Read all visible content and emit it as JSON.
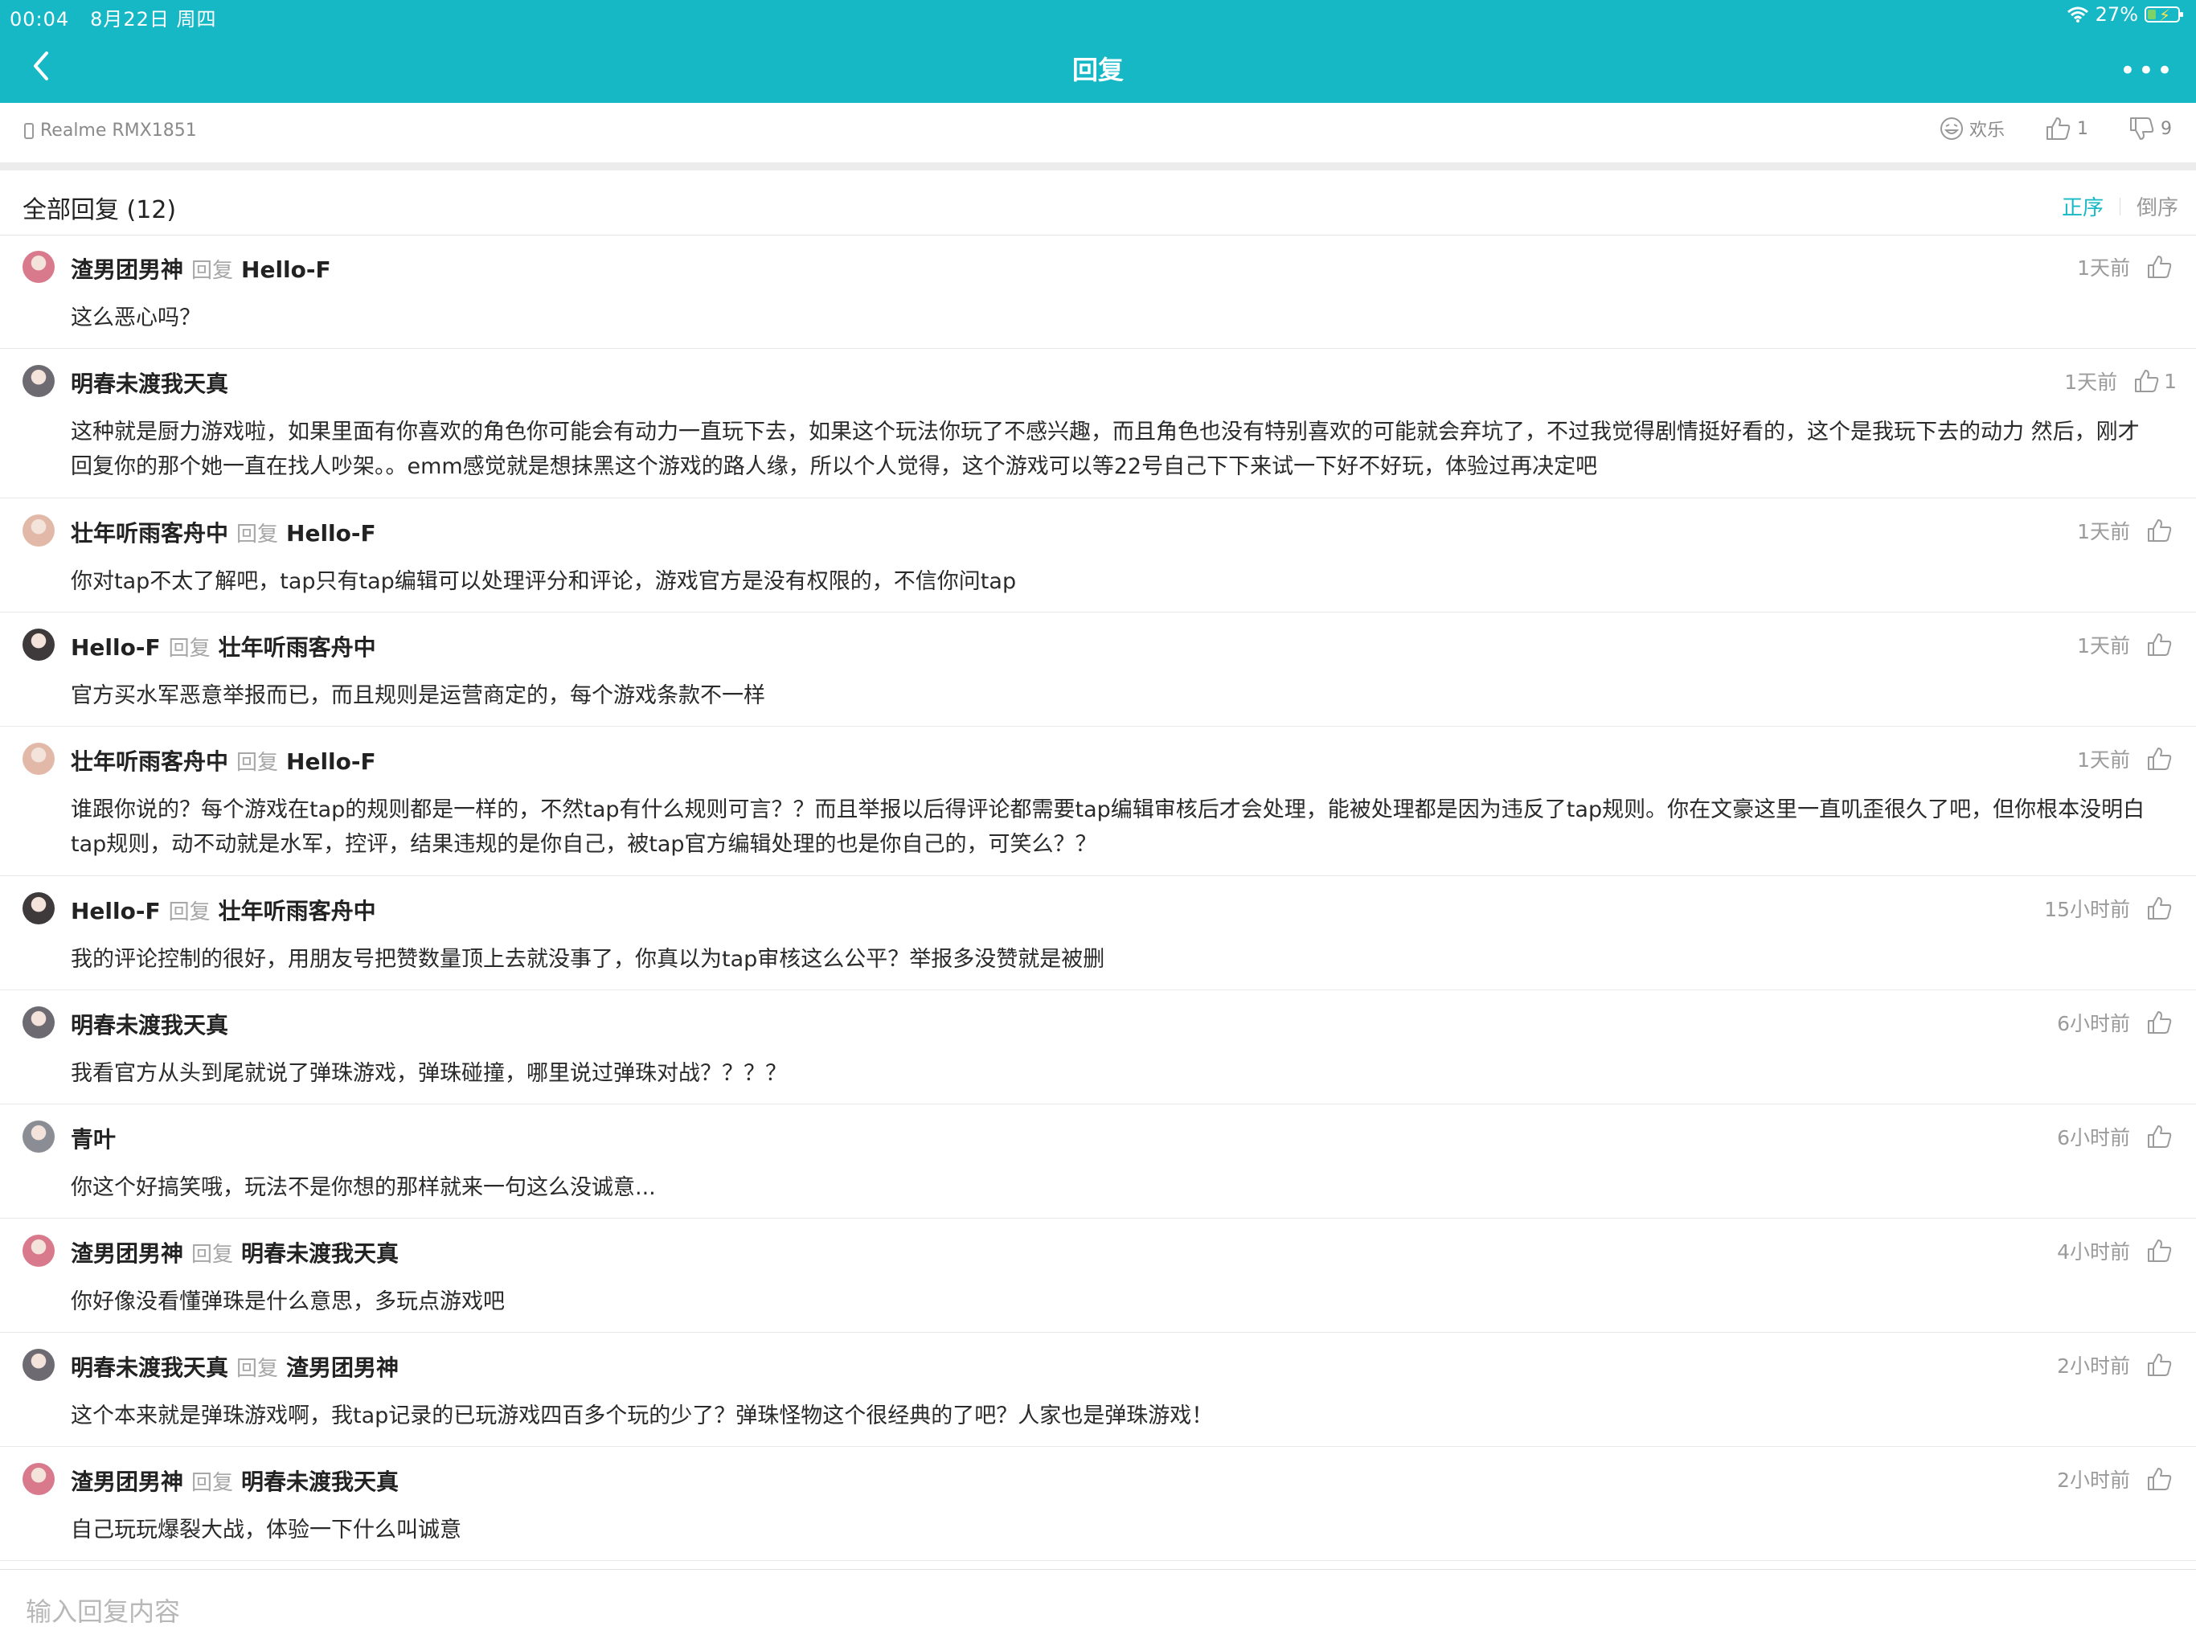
{
  "status_bar": {
    "time": "00:04",
    "date": "8月22日 周四",
    "battery": "27%"
  },
  "nav": {
    "title": "回复"
  },
  "device": {
    "label": "Realme RMX1851"
  },
  "actions": {
    "mood_label": "欢乐",
    "up_count": "1",
    "down_count": "9"
  },
  "section": {
    "title": "全部回复 (12)",
    "sort_asc": "正序",
    "sort_desc": "倒序"
  },
  "reply_word": "回复",
  "replies": [
    {
      "user": "渣男团男神",
      "to": "Hello-F",
      "time": "1天前",
      "likes": "",
      "text": "这么恶心吗？",
      "avatar": "#d9798c"
    },
    {
      "user": "明春未渡我天真",
      "to": "",
      "time": "1天前",
      "likes": "1",
      "text": "这种就是厨力游戏啦，如果里面有你喜欢的角色你可能会有动力一直玩下去，如果这个玩法你玩了不感兴趣，而且角色也没有特别喜欢的可能就会弃坑了，不过我觉得剧情挺好看的，这个是我玩下去的动力 然后，刚才回复你的那个她一直在找人吵架。。emm感觉就是想抹黑这个游戏的路人缘，所以个人觉得，这个游戏可以等22号自己下下来试一下好不好玩，体验过再决定吧",
      "avatar": "#6e6a72"
    },
    {
      "user": "壮年听雨客舟中",
      "to": "Hello-F",
      "time": "1天前",
      "likes": "",
      "text": "你对tap不太了解吧，tap只有tap编辑可以处理评分和评论，游戏官方是没有权限的，不信你问tap",
      "avatar": "#e2b9a8"
    },
    {
      "user": "Hello-F",
      "to": "壮年听雨客舟中",
      "time": "1天前",
      "likes": "",
      "text": "官方买水军恶意举报而已，而且规则是运营商定的，每个游戏条款不一样",
      "avatar": "#3e3a3c"
    },
    {
      "user": "壮年听雨客舟中",
      "to": "Hello-F",
      "time": "1天前",
      "likes": "",
      "text": "谁跟你说的？每个游戏在tap的规则都是一样的，不然tap有什么规则可言？？而且举报以后得评论都需要tap编辑审核后才会处理，能被处理都是因为违反了tap规则。你在文豪这里一直叽歪很久了吧，但你根本没明白tap规则，动不动就是水军，控评，结果违规的是你自己，被tap官方编辑处理的也是你自己的，可笑么？？",
      "avatar": "#e2b9a8"
    },
    {
      "user": "Hello-F",
      "to": "壮年听雨客舟中",
      "time": "15小时前",
      "likes": "",
      "text": "我的评论控制的很好，用朋友号把赞数量顶上去就没事了，你真以为tap审核这么公平？举报多没赞就是被删",
      "avatar": "#3e3a3c"
    },
    {
      "user": "明春未渡我天真",
      "to": "",
      "time": "6小时前",
      "likes": "",
      "text": "我看官方从头到尾就说了弹珠游戏，弹珠碰撞，哪里说过弹珠对战？？？？",
      "avatar": "#6e6a72"
    },
    {
      "user": "青叶",
      "to": "",
      "time": "6小时前",
      "likes": "",
      "text": "你这个好搞笑哦，玩法不是你想的那样就来一句这么没诚意...",
      "avatar": "#8a8d93"
    },
    {
      "user": "渣男团男神",
      "to": "明春未渡我天真",
      "time": "4小时前",
      "likes": "",
      "text": "你好像没看懂弹珠是什么意思，多玩点游戏吧",
      "avatar": "#d9798c"
    },
    {
      "user": "明春未渡我天真",
      "to": "渣男团男神",
      "time": "2小时前",
      "likes": "",
      "text": "这个本来就是弹珠游戏啊，我tap记录的已玩游戏四百多个玩的少了？弹珠怪物这个很经典的了吧？人家也是弹珠游戏！",
      "avatar": "#6e6a72"
    },
    {
      "user": "渣男团男神",
      "to": "明春未渡我天真",
      "time": "2小时前",
      "likes": "",
      "text": "自己玩玩爆裂大战，体验一下什么叫诚意",
      "avatar": "#d9798c"
    }
  ],
  "composer": {
    "placeholder": "输入回复内容"
  }
}
